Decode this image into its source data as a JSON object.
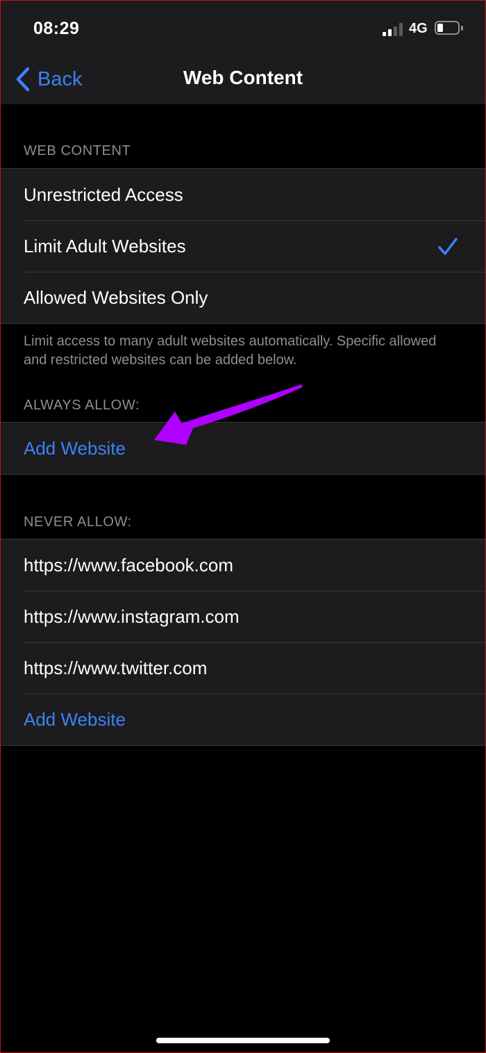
{
  "status_bar": {
    "time": "08:29",
    "network": "4G",
    "signal_bars_active": 2,
    "signal_bars_total": 4,
    "battery_percent": 30
  },
  "nav": {
    "back_label": "Back",
    "title": "Web Content"
  },
  "web_content": {
    "header": "WEB CONTENT",
    "options": [
      {
        "label": "Unrestricted Access"
      },
      {
        "label": "Limit Adult Websites"
      },
      {
        "label": "Allowed Websites Only"
      }
    ],
    "selected": "Limit Adult Websites",
    "footer": "Limit access to many adult websites automatically. Specific allowed and restricted websites can be added below."
  },
  "always_allow": {
    "header": "ALWAYS ALLOW:",
    "add_label": "Add Website"
  },
  "never_allow": {
    "header": "NEVER ALLOW:",
    "sites": [
      "https://www.facebook.com",
      "https://www.instagram.com",
      "https://www.twitter.com"
    ],
    "add_label": "Add Website"
  },
  "colors": {
    "accent": "#3b82f6",
    "annotation_arrow": "#b000ff",
    "background": "#000000",
    "cell_background": "#1c1c1e",
    "secondary_text": "#8e8e93"
  },
  "icons": {
    "back": "chevron-left-icon",
    "selected": "checkmark-icon",
    "signal": "signal-icon",
    "battery": "battery-icon"
  }
}
